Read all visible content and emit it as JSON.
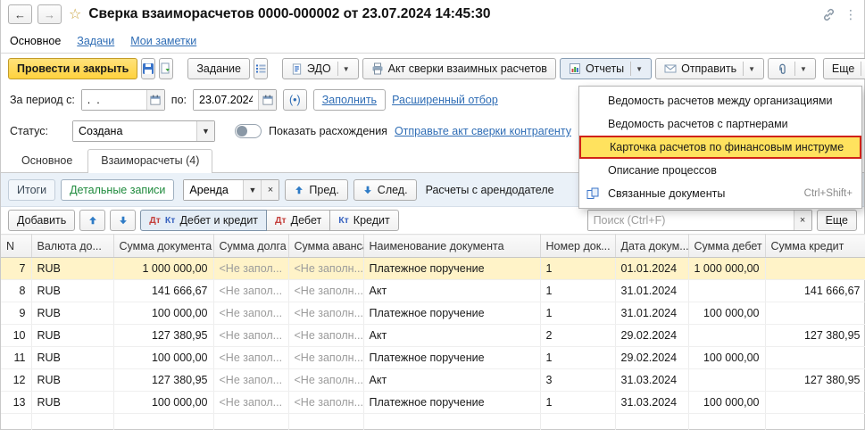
{
  "header": {
    "title": "Сверка взаиморасчетов 0000-000002 от 23.07.2024 14:45:30"
  },
  "nav": {
    "items": [
      {
        "label": "Основное"
      },
      {
        "label": "Задачи"
      },
      {
        "label": "Мои заметки"
      }
    ]
  },
  "toolbar": {
    "post_and_close": "Провести и закрыть",
    "task": "Задание",
    "edo": "ЭДО",
    "reconciliation_act": "Акт сверки взаимных расчетов",
    "reports": "Отчеты",
    "send": "Отправить",
    "more": "Еще"
  },
  "filters": {
    "period_from_label": "За период с:",
    "period_from_value": ".  .",
    "period_to_label": "по:",
    "period_to_value": "23.07.2024",
    "period_button": "(•)",
    "fill_button": "Заполнить",
    "advanced_filter_link": "Расширенный отбор",
    "status_label": "Статус:",
    "status_value": "Создана",
    "show_discrepancies_label": "Показать расхождения",
    "send_act_link": "Отправьте акт сверки контрагенту"
  },
  "tabs": [
    {
      "label": "Основное"
    },
    {
      "label": "Взаиморасчеты (4)"
    }
  ],
  "subtoolbar": {
    "totals": "Итоги",
    "detailed": "Детальные записи",
    "combo_value": "Аренда",
    "prev": "Пред.",
    "next": "След.",
    "caption": "Расчеты с арендодателе"
  },
  "list_toolbar": {
    "add": "Добавить",
    "dt": "Дт",
    "kt": "Кт",
    "debit_credit": "Дебет и кредит",
    "debit": "Дебет",
    "credit": "Кредит",
    "search_placeholder": "Поиск (Ctrl+F)",
    "more": "Еще"
  },
  "reports_menu": {
    "items": [
      {
        "label": "Ведомость расчетов между организациями"
      },
      {
        "label": "Ведомость расчетов с партнерами"
      },
      {
        "label": "Карточка расчетов по финансовым инструментам",
        "highlighted": true
      },
      {
        "label": "Описание процессов"
      },
      {
        "label": "Связанные документы",
        "shortcut": "Ctrl+Shift+",
        "icon": "linked-docs-icon"
      }
    ]
  },
  "table": {
    "columns": [
      "N",
      "Валюта до...",
      "Сумма документа",
      "Сумма долга",
      "Сумма аванса",
      "Наименование документа",
      "Номер док...",
      "Дата докум...",
      "Сумма дебет",
      "Сумма кредит"
    ],
    "empty_debt": "<Не запол...",
    "empty_advance": "<Не заполн...",
    "rows": [
      {
        "n": "7",
        "currency": "RUB",
        "amount": "1 000 000,00",
        "doc": "Платежное поручение",
        "num": "1",
        "date": "01.01.2024",
        "debit": "1 000 000,00",
        "credit": "",
        "selected": true
      },
      {
        "n": "8",
        "currency": "RUB",
        "amount": "141 666,67",
        "doc": "Акт",
        "num": "1",
        "date": "31.01.2024",
        "debit": "",
        "credit": "141 666,67"
      },
      {
        "n": "9",
        "currency": "RUB",
        "amount": "100 000,00",
        "doc": "Платежное поручение",
        "num": "1",
        "date": "31.01.2024",
        "debit": "100 000,00",
        "credit": ""
      },
      {
        "n": "10",
        "currency": "RUB",
        "amount": "127 380,95",
        "doc": "Акт",
        "num": "2",
        "date": "29.02.2024",
        "debit": "",
        "credit": "127 380,95"
      },
      {
        "n": "11",
        "currency": "RUB",
        "amount": "100 000,00",
        "doc": "Платежное поручение",
        "num": "1",
        "date": "29.02.2024",
        "debit": "100 000,00",
        "credit": ""
      },
      {
        "n": "12",
        "currency": "RUB",
        "amount": "127 380,95",
        "doc": "Акт",
        "num": "3",
        "date": "31.03.2024",
        "debit": "",
        "credit": "127 380,95"
      },
      {
        "n": "13",
        "currency": "RUB",
        "amount": "100 000,00",
        "doc": "Платежное поручение",
        "num": "1",
        "date": "31.03.2024",
        "debit": "100 000,00",
        "credit": ""
      }
    ]
  }
}
